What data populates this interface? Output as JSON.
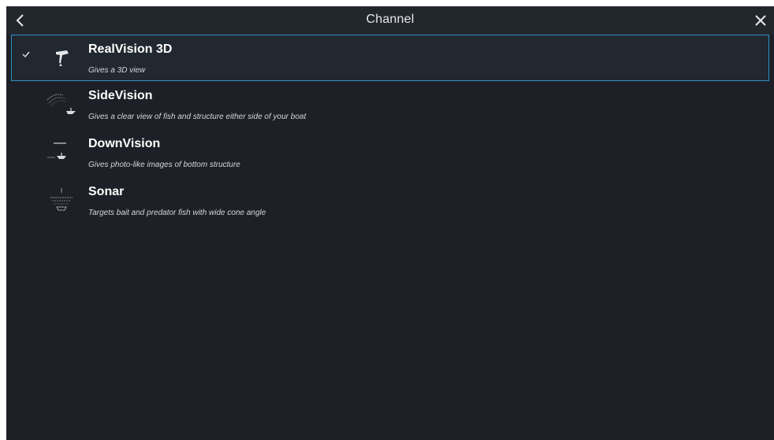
{
  "header": {
    "title": "Channel",
    "back_icon": "chevron-left-icon",
    "close_icon": "close-icon"
  },
  "colors": {
    "background": "#1d2026",
    "header": "#22262d",
    "selection_border": "#2f8fc8",
    "text": "#ffffff"
  },
  "channels": [
    {
      "name": "RealVision 3D",
      "description": "Gives a 3D view",
      "icon": "realvision-3d-icon",
      "selected": true
    },
    {
      "name": "SideVision",
      "description": "Gives a clear view of fish and structure either side of your boat",
      "icon": "sidevision-icon",
      "selected": false
    },
    {
      "name": "DownVision",
      "description": "Gives photo-like images of bottom structure",
      "icon": "downvision-icon",
      "selected": false
    },
    {
      "name": "Sonar",
      "description": "Targets bait and predator fish with wide cone angle",
      "icon": "sonar-icon",
      "selected": false
    }
  ]
}
